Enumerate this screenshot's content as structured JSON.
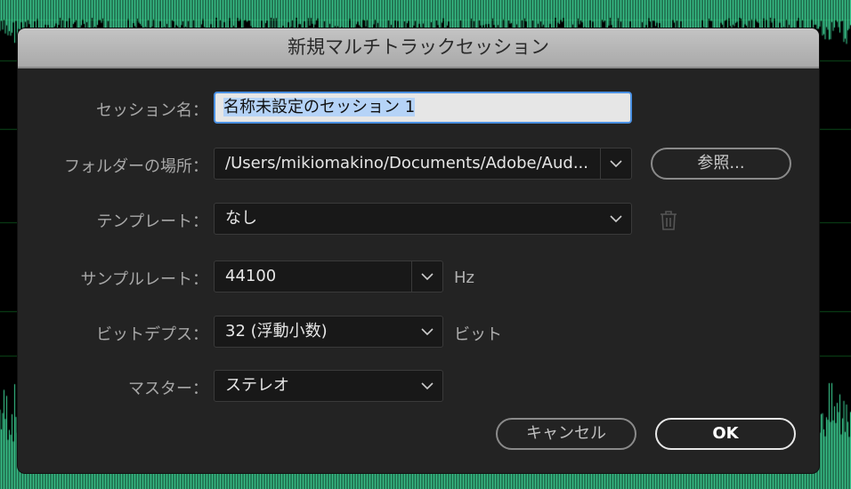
{
  "dialog": {
    "title": "新規マルチトラックセッション",
    "session_name": {
      "label": "セッション名：",
      "value": "名称未設定のセッション 1"
    },
    "folder": {
      "label": "フォルダーの場所：",
      "value": "/Users/mikiomakino/Documents/Adobe/Aud...",
      "browse_label": "参照..."
    },
    "template": {
      "label": "テンプレート：",
      "value": "なし"
    },
    "sample_rate": {
      "label": "サンプルレート：",
      "value": "44100",
      "unit": "Hz"
    },
    "bit_depth": {
      "label": "ビットデプス：",
      "value": "32 (浮動小数)",
      "unit": "ビット"
    },
    "master": {
      "label": "マスター：",
      "value": "ステレオ"
    },
    "cancel_label": "キャンセル",
    "ok_label": "OK"
  },
  "colors": {
    "waveform": "#3fd89a",
    "accent": "#4a90e2"
  }
}
